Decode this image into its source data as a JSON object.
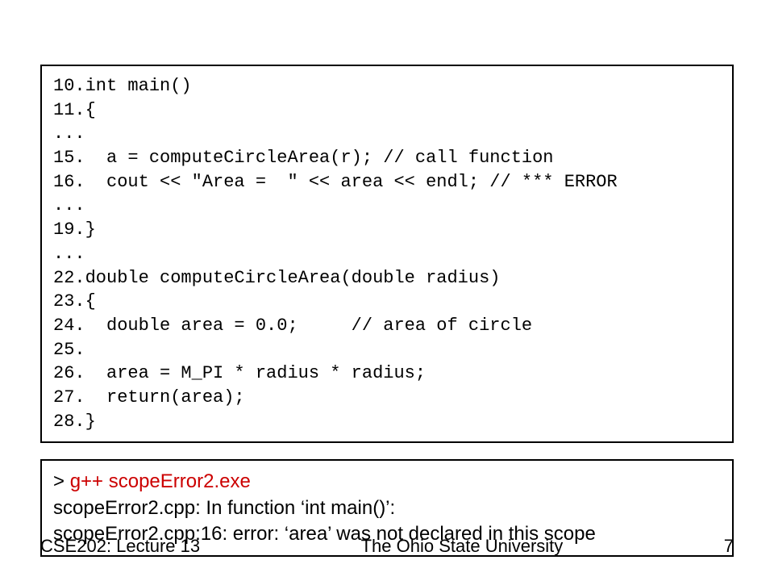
{
  "code": {
    "lines": [
      "10.int main()",
      "11.{",
      "...",
      "15.  a = computeCircleArea(r); // call function",
      "16.  cout << \"Area =  \" << area << endl; // *** ERROR",
      "...",
      "19.}",
      "...",
      "22.double computeCircleArea(double radius)",
      "23.{",
      "24.  double area = 0.0;     // area of circle",
      "25.",
      "26.  area = M_PI * radius * radius;",
      "27.  return(area);",
      "28.}"
    ]
  },
  "console": {
    "prompt": "> ",
    "cmd": "g++ scopeError2.exe",
    "out1": "scopeError2.cpp: In function ‘int main()’:",
    "out2": "scopeError2.cpp:16: error: ‘area’ was not declared in this scope"
  },
  "footer": {
    "left": "CSE202: Lecture 13",
    "center": "The Ohio State University",
    "right": "7"
  }
}
